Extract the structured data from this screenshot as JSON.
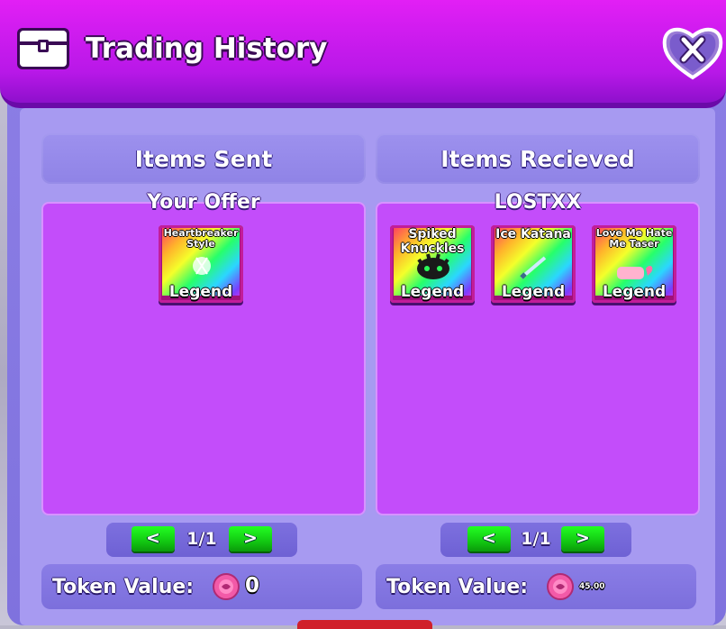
{
  "header": {
    "title": "Trading History",
    "close_icon": "x-icon"
  },
  "left": {
    "heading": "Items Sent",
    "owner": "Your Offer",
    "items": [
      {
        "name": "Heartbreaker Style",
        "rarity": "Legend"
      }
    ],
    "pager": {
      "prev": "<",
      "page": "1/1",
      "next": ">"
    },
    "token_label": "Token Value:",
    "token_value": "0"
  },
  "right": {
    "heading": "Items Recieved",
    "owner": "LOSTXX",
    "items": [
      {
        "name": "Spiked Knuckles",
        "rarity": "Legend"
      },
      {
        "name": "Ice Katana",
        "rarity": "Legend"
      },
      {
        "name": "Love Me Hate Me Taser",
        "rarity": "Legend"
      }
    ],
    "pager": {
      "prev": "<",
      "page": "1/1",
      "next": ">"
    },
    "token_label": "Token Value:",
    "token_value": "45.00"
  },
  "colors": {
    "header": "#d91cf2",
    "panel": "#8d7fe6",
    "box": "#c34dfa",
    "button": "#18e018",
    "coin": "#f25aa8"
  }
}
